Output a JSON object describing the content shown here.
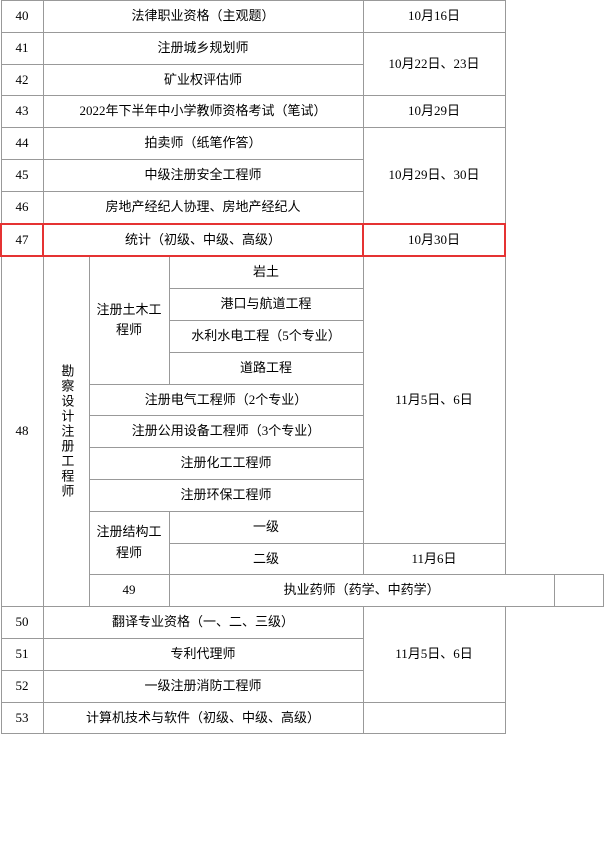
{
  "rows": [
    {
      "num": "40",
      "name": "法律职业资格（主观题）",
      "date": "10月16日",
      "highlight": false,
      "merged": false
    },
    {
      "num": "41",
      "name": "注册城乡规划师",
      "date": "10月22日、23日",
      "highlight": false,
      "merged": false,
      "dateRowspan": 2
    },
    {
      "num": "42",
      "name": "矿业权评估师",
      "date": "",
      "highlight": false,
      "merged": false
    },
    {
      "num": "43",
      "name": "2022年下半年中小学教师资格考试（笔试）",
      "date": "10月29日",
      "highlight": false,
      "merged": false
    },
    {
      "num": "44",
      "name": "拍卖师（纸笔作答）",
      "date": "10月29日、30日",
      "highlight": false,
      "merged": false,
      "dateRowspan": 3
    },
    {
      "num": "45",
      "name": "中级注册安全工程师",
      "date": "",
      "highlight": false,
      "merged": false
    },
    {
      "num": "46",
      "name": "房地产经纪人协理、房地产经纪人",
      "date": "",
      "highlight": false,
      "merged": false
    },
    {
      "num": "47",
      "name": "统计（初级、中级、高级）",
      "date": "10月30日",
      "highlight": true,
      "merged": false
    },
    {
      "num": "48",
      "name_complex": true,
      "date": "11月5日、6日",
      "highlight": false,
      "merged": true
    },
    {
      "num": "49",
      "name": "执业药师（药学、中药学）",
      "date": "",
      "highlight": false,
      "merged": false
    },
    {
      "num": "50",
      "name": "翻译专业资格（一、二、三级）",
      "date": "",
      "highlight": false,
      "merged": false,
      "dateRowspan": 3
    },
    {
      "num": "51",
      "name": "专利代理师",
      "date": "11月5日、6日",
      "highlight": false,
      "merged": false
    },
    {
      "num": "52",
      "name": "一级注册消防工程师",
      "date": "",
      "highlight": false,
      "merged": false
    },
    {
      "num": "53",
      "name": "计算机技术与软件（初级、中级、高级）",
      "date": "",
      "highlight": false,
      "merged": false
    }
  ],
  "row48": {
    "sub_groups": [
      {
        "group_label": "勘察设计注册工程师",
        "sub1_label": "注册土木工程师",
        "items": [
          "岩土",
          "港口与航道工程",
          "水利水电工程（5个专业）",
          "道路工程"
        ]
      },
      {
        "group_label": "",
        "sub1_label": "注册电气工程师（2个专业）",
        "items": []
      },
      {
        "group_label": "",
        "sub1_label": "注册公用设备工程师（3个专业）",
        "items": []
      },
      {
        "group_label": "",
        "sub1_label": "注册化工工程师",
        "items": []
      },
      {
        "group_label": "",
        "sub1_label": "注册环保工程师",
        "items": []
      },
      {
        "group_label": "",
        "sub1_label": "注册结构工程师",
        "items": [
          "一级",
          "二级"
        ]
      }
    ],
    "date_main": "11月5日、6日",
    "date_sub": "11月6日"
  }
}
